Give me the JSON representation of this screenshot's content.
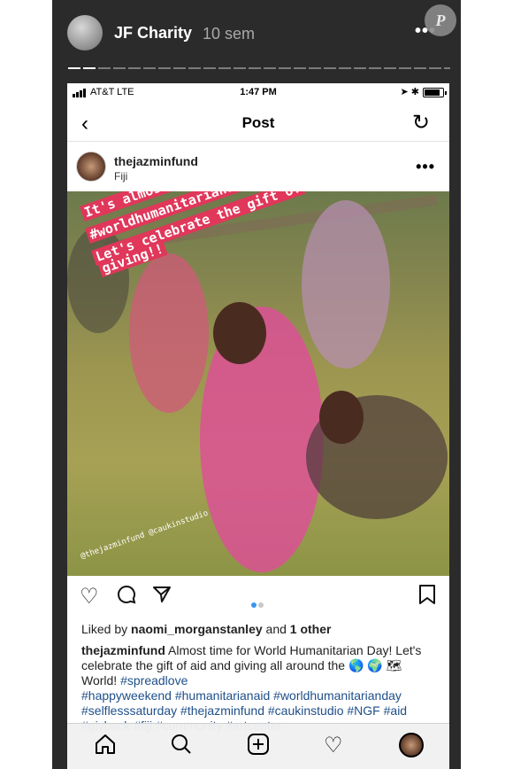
{
  "story": {
    "account_name": "JF Charity",
    "time_ago": "10 sem",
    "more_icon": "ellipsis-icon",
    "badge_letter": "P",
    "progress_fraction": 0.07
  },
  "status_bar": {
    "carrier": "AT&T  LTE",
    "time": "1:47 PM",
    "icons": "➤ ✱"
  },
  "nav": {
    "back": "‹",
    "title": "Post",
    "refresh": "↻"
  },
  "post": {
    "username": "thejazminfund",
    "location": "Fiji",
    "more": "•••",
    "overlay_lines": [
      "It's almost",
      "#worldhumanitarianday !!",
      "Let's celebrate the gift of",
      "giving!!"
    ],
    "photo_credit": "@thejazminfund @caukinstudio",
    "carousel_index": 1,
    "carousel_count": 2,
    "likes_prefix": "Liked by",
    "likes_user": "naomi_morganstanley",
    "likes_and": "and",
    "likes_other": "1 other",
    "caption_user": "thejazminfund",
    "caption_text": "Almost time for World Humanitarian Day! Let's celebrate the gift of aid and giving all around the 🌎 🌍 🗺 World!",
    "caption_tag1": "#spreadlove",
    "caption_tags": "#happyweekend #humanitarianaid #worldhumanitarianday #selflesssaturday #thejazminfund #caukinstudio #NGF #aid #givback #fiji #community #artcenter"
  },
  "actions": {
    "like_icon": "heart-icon",
    "comment_icon": "comment-icon",
    "share_icon": "send-icon",
    "save_icon": "bookmark-icon"
  },
  "tabbar": {
    "home_icon": "home-icon",
    "search_icon": "search-icon",
    "add_icon": "add-icon",
    "activity_icon": "heart-icon",
    "profile_icon": "profile-avatar"
  },
  "colors": {
    "story_bg": "#2b2b2b",
    "overlay_bg": "#e0375a",
    "hashtag": "#1e4f8a",
    "carousel_active": "#3897f0"
  }
}
